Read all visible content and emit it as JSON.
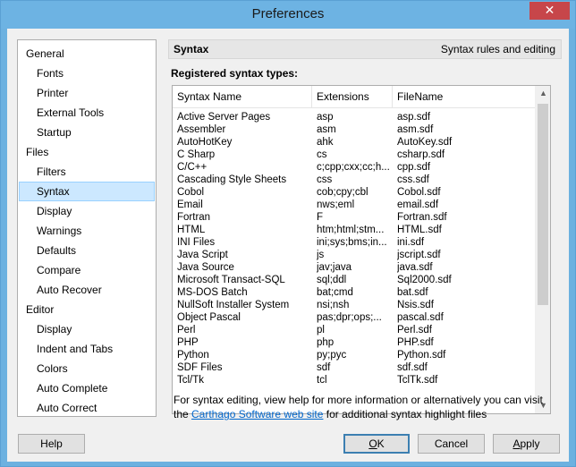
{
  "window": {
    "title": "Preferences",
    "close_glyph": "✕"
  },
  "nav": {
    "items": [
      {
        "label": "General",
        "level": 0
      },
      {
        "label": "Fonts",
        "level": 1
      },
      {
        "label": "Printer",
        "level": 1
      },
      {
        "label": "External Tools",
        "level": 1
      },
      {
        "label": "Startup",
        "level": 1
      },
      {
        "label": "Files",
        "level": 0
      },
      {
        "label": "Filters",
        "level": 1
      },
      {
        "label": "Syntax",
        "level": 1,
        "selected": true
      },
      {
        "label": "Display",
        "level": 1
      },
      {
        "label": "Warnings",
        "level": 1
      },
      {
        "label": "Defaults",
        "level": 1
      },
      {
        "label": "Compare",
        "level": 1
      },
      {
        "label": "Auto Recover",
        "level": 1
      },
      {
        "label": "Editor",
        "level": 0
      },
      {
        "label": "Display",
        "level": 1
      },
      {
        "label": "Indent and Tabs",
        "level": 1
      },
      {
        "label": "Colors",
        "level": 1
      },
      {
        "label": "Auto Complete",
        "level": 1
      },
      {
        "label": "Auto Correct",
        "level": 1
      }
    ]
  },
  "panel": {
    "title": "Syntax",
    "subtitle": "Syntax rules and editing",
    "registered_label": "Registered syntax types:"
  },
  "table": {
    "columns": [
      "Syntax Name",
      "Extensions",
      "FileName"
    ],
    "rows": [
      [
        "Active Server Pages",
        "asp",
        "asp.sdf"
      ],
      [
        "Assembler",
        "asm",
        "asm.sdf"
      ],
      [
        "AutoHotKey",
        "ahk",
        "AutoKey.sdf"
      ],
      [
        "C Sharp",
        "cs",
        "csharp.sdf"
      ],
      [
        "C/C++",
        "c;cpp;cxx;cc;h...",
        "cpp.sdf"
      ],
      [
        "Cascading Style Sheets",
        "css",
        "css.sdf"
      ],
      [
        "Cobol",
        "cob;cpy;cbl",
        "Cobol.sdf"
      ],
      [
        "Email",
        "nws;eml",
        "email.sdf"
      ],
      [
        "Fortran",
        "F",
        "Fortran.sdf"
      ],
      [
        "HTML",
        "htm;html;stm...",
        "HTML.sdf"
      ],
      [
        "INI Files",
        "ini;sys;bms;in...",
        "ini.sdf"
      ],
      [
        "Java Script",
        "js",
        "jscript.sdf"
      ],
      [
        "Java Source",
        "jav;java",
        "java.sdf"
      ],
      [
        "Microsoft Transact-SQL",
        "sql;ddl",
        "Sql2000.sdf"
      ],
      [
        "MS-DOS Batch",
        "bat;cmd",
        "bat.sdf"
      ],
      [
        "NullSoft Installer System",
        "nsi;nsh",
        "Nsis.sdf"
      ],
      [
        "Object Pascal",
        "pas;dpr;ops;...",
        "pascal.sdf"
      ],
      [
        "Perl",
        "pl",
        "Perl.sdf"
      ],
      [
        "PHP",
        "php",
        "PHP.sdf"
      ],
      [
        "Python",
        "py;pyc",
        "Python.sdf"
      ],
      [
        "SDF Files",
        "sdf",
        "sdf.sdf"
      ],
      [
        "Tcl/Tk",
        "tcl",
        "TclTk.sdf"
      ]
    ]
  },
  "footnote": {
    "text_before": "For syntax editing, view help for more information or alternatively you can visit the ",
    "link": "Carthago Software web site",
    "text_after": " for additional syntax highlight files"
  },
  "buttons": {
    "help": "Help",
    "ok": "OK",
    "cancel": "Cancel",
    "apply": "Apply"
  }
}
